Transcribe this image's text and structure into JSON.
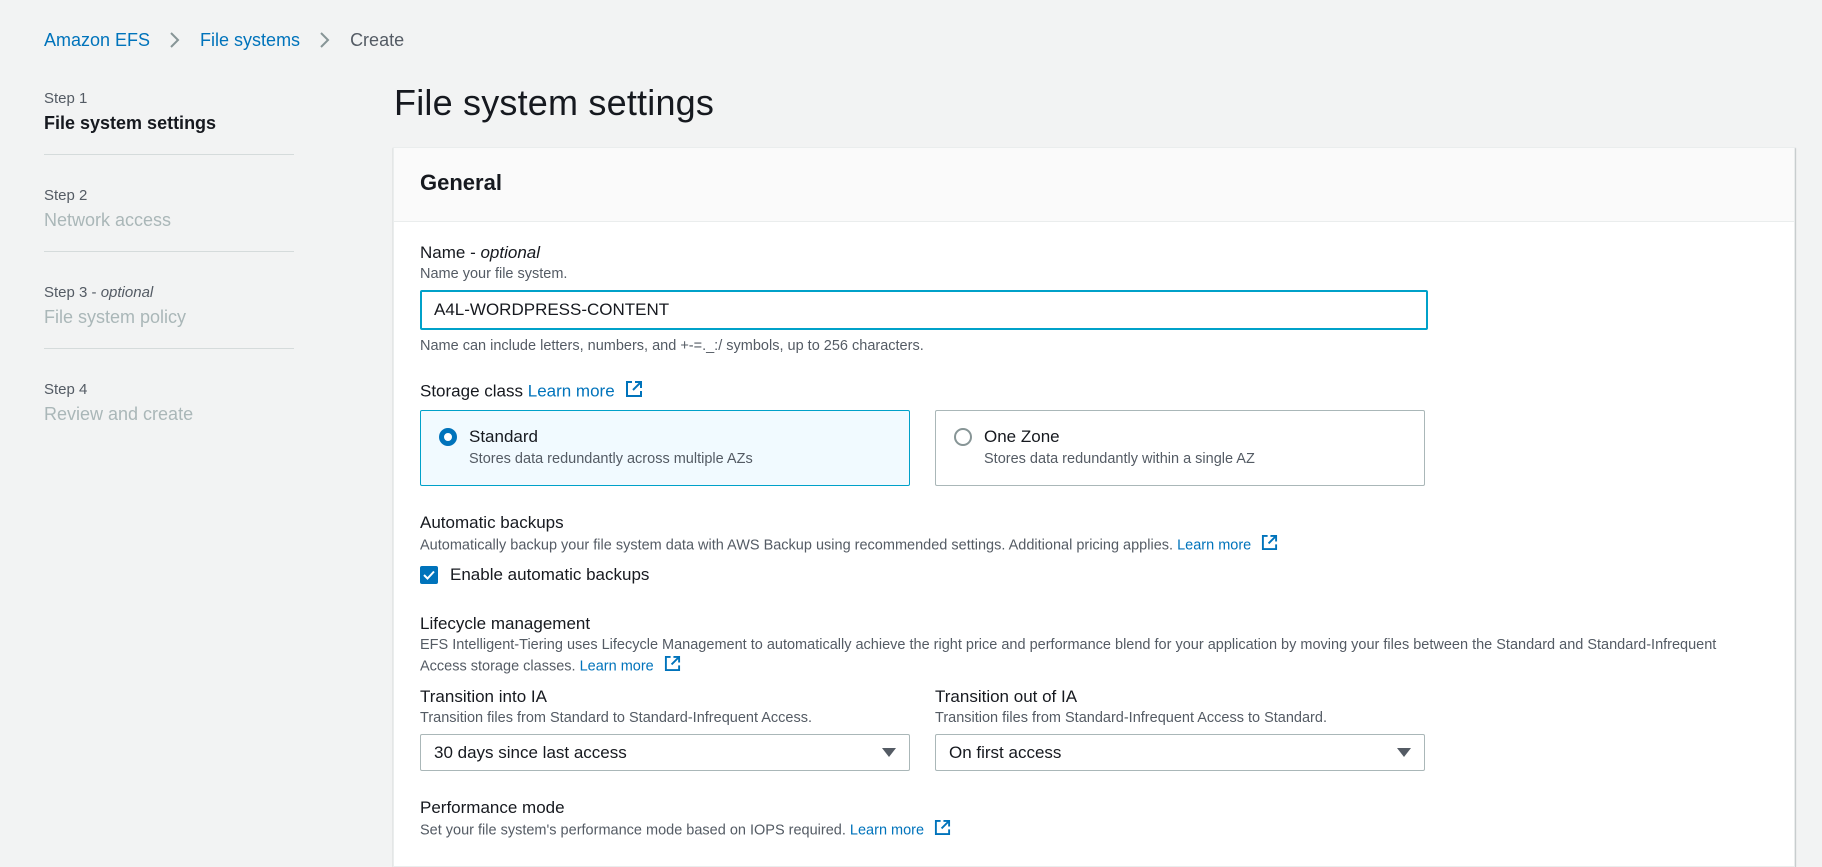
{
  "breadcrumb": {
    "items": [
      "Amazon EFS",
      "File systems"
    ],
    "current": "Create"
  },
  "steps": [
    {
      "num": "Step 1",
      "title": "File system settings"
    },
    {
      "num": "Step 2",
      "title": "Network access"
    },
    {
      "num": "Step 3 - ",
      "num_optional": "optional",
      "title": "File system policy"
    },
    {
      "num": "Step 4",
      "title": "Review and create"
    }
  ],
  "page_title": "File system settings",
  "general": {
    "header": "General",
    "name": {
      "label": "Name - ",
      "label_optional": "optional",
      "description": "Name your file system.",
      "value": "A4L-WORDPRESS-CONTENT",
      "hint": "Name can include letters, numbers, and +-=._:/ symbols, up to 256 characters."
    },
    "storage_class": {
      "label": "Storage class",
      "learn_more": "Learn more",
      "options": [
        {
          "title": "Standard",
          "desc": "Stores data redundantly across multiple AZs",
          "selected": true
        },
        {
          "title": "One Zone",
          "desc": "Stores data redundantly within a single AZ",
          "selected": false
        }
      ]
    },
    "backups": {
      "label": "Automatic backups",
      "description": "Automatically backup your file system data with AWS Backup using recommended settings. Additional pricing applies.",
      "learn_more": "Learn more",
      "checkbox_label": "Enable automatic backups"
    },
    "lifecycle": {
      "label": "Lifecycle management",
      "description": "EFS Intelligent-Tiering uses Lifecycle Management to automatically achieve the right price and performance blend for your application by moving your files between the Standard and Standard-Infrequent Access storage classes.",
      "learn_more": "Learn more",
      "transition_in": {
        "label": "Transition into IA",
        "desc": "Transition files from Standard to Standard-Infrequent Access.",
        "value": "30 days since last access"
      },
      "transition_out": {
        "label": "Transition out of IA",
        "desc": "Transition files from Standard-Infrequent Access to Standard.",
        "value": "On first access"
      }
    },
    "performance": {
      "label": "Performance mode",
      "description": "Set your file system's performance mode based on IOPS required.",
      "learn_more": "Learn more"
    }
  },
  "colors": {
    "link": "#0073bb",
    "focus": "#00a1c9",
    "background": "#f2f3f3"
  }
}
